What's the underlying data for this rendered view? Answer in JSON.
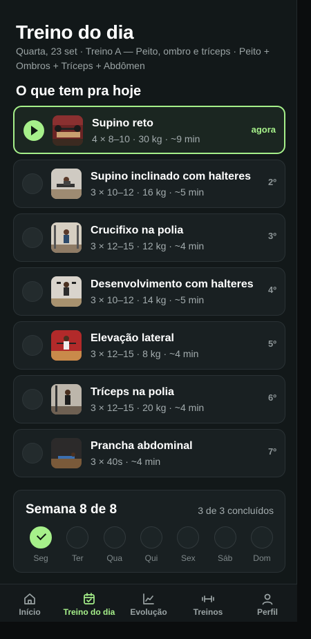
{
  "header": {
    "title": "Treino do dia",
    "subtitle": "Quarta, 23 set · Treino A — Peito, ombro e tríceps · Peito + Ombros + Tríceps + Abdômen"
  },
  "section_title": "O que tem pra hoje",
  "exercises": [
    {
      "name": "Supino reto",
      "meta": "4 × 8–10 · 30 kg · ~9 min",
      "order": "agora",
      "active": true
    },
    {
      "name": "Supino inclinado com halteres",
      "meta": "3 × 10–12 · 16 kg · ~5 min",
      "order": "2º",
      "active": false
    },
    {
      "name": "Crucifixo na polia",
      "meta": "3 × 12–15 · 12 kg · ~4 min",
      "order": "3º",
      "active": false
    },
    {
      "name": "Desenvolvimento com halteres",
      "meta": "3 × 10–12 · 14 kg · ~5 min",
      "order": "4º",
      "active": false
    },
    {
      "name": "Elevação lateral",
      "meta": "3 × 12–15 · 8 kg · ~4 min",
      "order": "5º",
      "active": false
    },
    {
      "name": "Tríceps na polia",
      "meta": "3 × 12–15 · 20 kg · ~4 min",
      "order": "6º",
      "active": false
    },
    {
      "name": "Prancha abdominal",
      "meta": "3 × 40s · ~4 min",
      "order": "7º",
      "active": false
    }
  ],
  "week": {
    "title": "Semana 8 de 8",
    "count": "3 de 3 concluídos",
    "days": [
      {
        "label": "Seg",
        "done": true
      },
      {
        "label": "Ter",
        "done": false
      },
      {
        "label": "Qua",
        "done": false
      },
      {
        "label": "Qui",
        "done": false
      },
      {
        "label": "Sex",
        "done": false
      },
      {
        "label": "Sáb",
        "done": false
      },
      {
        "label": "Dom",
        "done": false
      }
    ]
  },
  "tabs": [
    {
      "label": "Início",
      "icon": "home-icon",
      "active": false
    },
    {
      "label": "Treino do dia",
      "icon": "calendar-check-icon",
      "active": true
    },
    {
      "label": "Evolução",
      "icon": "chart-line-icon",
      "active": false
    },
    {
      "label": "Treinos",
      "icon": "dumbbell-icon",
      "active": false
    },
    {
      "label": "Perfil",
      "icon": "user-icon",
      "active": false
    }
  ],
  "colors": {
    "accent": "#a6f08a",
    "background": "#121819",
    "card": "#192022"
  }
}
